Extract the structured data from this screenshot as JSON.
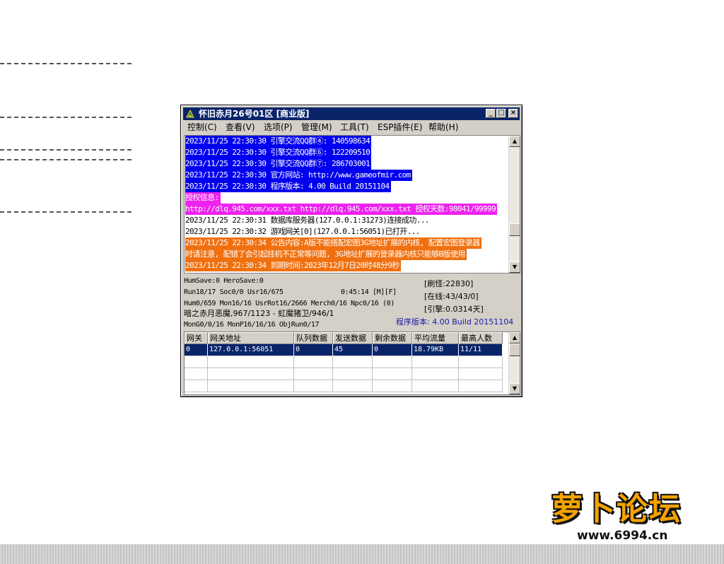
{
  "window": {
    "title": "怀旧赤月26号01区 [商业版]",
    "buttons": {
      "minimize": "_",
      "maximize": "□",
      "close": "×"
    }
  },
  "menu": [
    "控制(C)",
    "查看(V)",
    "选项(P)",
    "管理(M)",
    "工具(T)",
    "ESP插件(E)",
    "帮助(H)"
  ],
  "log": [
    {
      "text": "2023/11/25 22:30:30 引擎交流QQ群④: 140598634",
      "bg": "#0000ee",
      "fg": "#ffffff"
    },
    {
      "text": "2023/11/25 22:30:30 引擎交流QQ群⑥: 122209510",
      "bg": "#0000ee",
      "fg": "#ffffff"
    },
    {
      "text": "2023/11/25 22:30:30 引擎交流QQ群⑦: 286703001",
      "bg": "#0000ee",
      "fg": "#ffffff"
    },
    {
      "text": "2023/11/25 22:30:30 官方网站: http://www.gameofmir.com",
      "bg": "#0000ee",
      "fg": "#ffffff"
    },
    {
      "text": "2023/11/25 22:30:30 程序版本: 4.00 Build 20151104",
      "bg": "#0000ee",
      "fg": "#ffffff"
    },
    {
      "text": "授权信息:",
      "bg": "#ee22ee",
      "fg": "#ffffff"
    },
    {
      "text": "http://dlq.945.com/xxx.txt http://dlq.945.com/xxx.txt 授权天数:98041/99999",
      "bg": "#ee22ee",
      "fg": "#ffffff"
    },
    {
      "text": "2023/11/25 22:30:31 数据库服务器(127.0.0.1:31273)连接成功...",
      "bg": "#ffffff",
      "fg": "#000000"
    },
    {
      "text": "2023/11/25 22:30:32 游戏网关[0](127.0.0.1:56051)已打开...",
      "bg": "#ffffff",
      "fg": "#000000"
    },
    {
      "text": "2023/11/25 22:30:34 公告内容:A版不能搭配宏图3G地址扩展的内核, 配置宏图登录器",
      "bg": "#f07010",
      "fg": "#ffffff"
    },
    {
      "text": "时请注意, 配错了会引起挂机不正常等问题, 3G地址扩展的登录器内核只能够B版使用",
      "bg": "#f07010",
      "fg": "#ffffff"
    },
    {
      "text": "2023/11/25 22:30:34 到期时间:2023年12月7日20时48分9秒",
      "bg": "#f07010",
      "fg": "#ffffff"
    }
  ],
  "status": {
    "line1": "HumSave:0 HeroSave:0",
    "line2": "Run18/17 Soc0/0 Usr16/675",
    "time": "0:45:14 [M][F]",
    "line3": "Hum0/659 Mon16/16 UsrRot16/2666 Merch0/16 Npc0/16 (0)",
    "line4": "暗之赤月恶魔,967/1123 - 虹魔猪卫/946/1",
    "line5": "MonG0/0/16 MonP16/16/16 ObjRun0/17",
    "refresh": "[刷怪:22830]",
    "online": "[在线:43/43/0]",
    "engine": "[引擎:0.0314天]",
    "version": "程序版本: 4.00 Build 20151104"
  },
  "grid": {
    "headers": [
      "网关",
      "网关地址",
      "队列数据",
      "发送数据",
      "剩余数据",
      "平均流量",
      "最高人数"
    ],
    "rows": [
      [
        "0",
        "127.0.0.1:56051",
        "0",
        "45",
        "0",
        "18.79KB",
        "11/11"
      ]
    ]
  },
  "watermark": {
    "logo": "萝卜论坛",
    "url": "www.6994.cn"
  }
}
